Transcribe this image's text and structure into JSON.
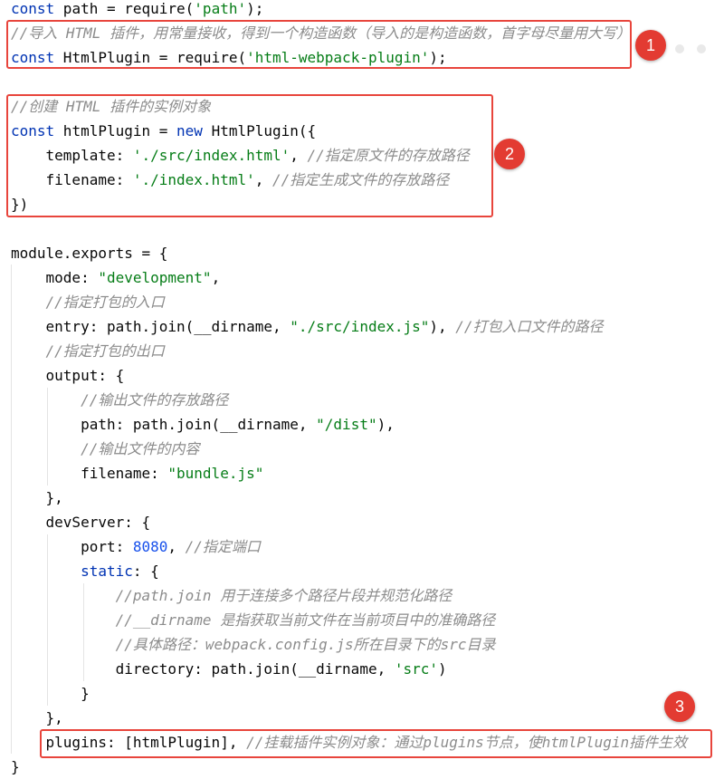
{
  "annotations": {
    "badge_1": "1",
    "badge_2": "2",
    "badge_3": "3"
  },
  "colors": {
    "keyword": "#0033b3",
    "string": "#067d17",
    "number": "#1750eb",
    "comment": "#8c8c8c",
    "annotation_red": "#e33b32"
  },
  "code": {
    "l1": {
      "kw": "const",
      "a": " path = require(",
      "str": "'path'",
      "b": ");"
    },
    "l2": {
      "cmt": "//导入 HTML 插件，用常量接收，得到一个构造函数（导入的是构造函数，首字母尽量用大写）"
    },
    "l3": {
      "kw": "const",
      "a": " HtmlPlugin = require(",
      "str": "'html-webpack-plugin'",
      "b": ");"
    },
    "l5": {
      "cmt": "//创建 HTML 插件的实例对象"
    },
    "l6": {
      "kw": "const",
      "a": " htmlPlugin = ",
      "kw2": "new",
      "b": " HtmlPlugin({"
    },
    "l7": {
      "a": "    template: ",
      "str": "'./src/index.html'",
      "b": ", ",
      "cmt": "//指定原文件的存放路径"
    },
    "l8": {
      "a": "    filename: ",
      "str": "'./index.html'",
      "b": ", ",
      "cmt": "//指定生成文件的存放路径"
    },
    "l9": {
      "a": "})"
    },
    "l11": {
      "a": "module.exports = {"
    },
    "l12": {
      "a": "    mode: ",
      "str": "\"development\"",
      "b": ","
    },
    "l13": {
      "cmt": "    //指定打包的入口"
    },
    "l14": {
      "a": "    entry: path.join(__dirname, ",
      "str": "\"./src/index.js\"",
      "b": "), ",
      "cmt": "//打包入口文件的路径"
    },
    "l15": {
      "cmt": "    //指定打包的出口"
    },
    "l16": {
      "a": "    output: {"
    },
    "l17": {
      "cmt": "        //输出文件的存放路径"
    },
    "l18": {
      "a": "        path: path.join(__dirname, ",
      "str": "\"/dist\"",
      "b": "),"
    },
    "l19": {
      "cmt": "        //输出文件的内容"
    },
    "l20": {
      "a": "        filename: ",
      "str": "\"bundle.js\""
    },
    "l21": {
      "a": "    },"
    },
    "l22": {
      "a": "    devServer: {"
    },
    "l23": {
      "a": "        port: ",
      "num": "8080",
      "b": ", ",
      "cmt": "//指定端口"
    },
    "l24": {
      "pre": "        ",
      "kw": "static",
      "b": ": {"
    },
    "l25": {
      "cmt": "            //path.join 用于连接多个路径片段并规范化路径"
    },
    "l26": {
      "cmt": "            //__dirname 是指获取当前文件在当前项目中的准确路径"
    },
    "l27": {
      "cmt": "            //具体路径：webpack.config.js所在目录下的src目录"
    },
    "l28": {
      "a": "            directory: path.join(__dirname, ",
      "str": "'src'",
      "b": ")"
    },
    "l29": {
      "a": "        }"
    },
    "l30": {
      "a": "    },"
    },
    "l31": {
      "a": "    plugins: [htmlPlugin], ",
      "cmt": "//挂载插件实例对象：通过plugins节点，使htmlPlugin插件生效"
    },
    "l32": {
      "a": "}"
    }
  }
}
